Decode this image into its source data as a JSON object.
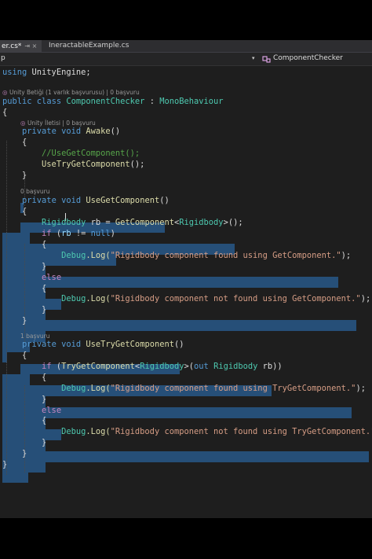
{
  "tabs": [
    {
      "label": "er.cs*",
      "pin": "⇥ ×"
    },
    {
      "label": "IneractableExample.cs"
    }
  ],
  "navbar": {
    "left": "p",
    "dropdown_glyph": "▾",
    "right": "ComponentChecker"
  },
  "code": {
    "using_kw": "using",
    "using_ns": " UnityEngine;",
    "lens_class": "Unity Betiği (1 varlık başvurusu) | 0 başvuru",
    "class_line": {
      "public": "public",
      "class": " class ",
      "name": "ComponentChecker",
      "colon": " : ",
      "base": "MonoBehaviour"
    },
    "brace_open": "{",
    "brace_close": "}",
    "lens_awake": "Unity İletisi | 0 başvuru",
    "awake_private": "private",
    "awake_void": " void ",
    "awake_name": "Awake",
    "parens": "()",
    "awake_comment": "//UseGetComponent();",
    "awake_call": "UseTryGetComponent",
    "call_end": "();",
    "lens_use": "0 başvuru",
    "use_name": "UseGetComponent",
    "rb_type": "Rigidbody",
    "rb_var": " rb = ",
    "get_comp": "GetComponent",
    "lt": "<",
    "gt_end": ">();",
    "if_kw": "if",
    "if_open": " (",
    "rb_name": "rb",
    "neq": " != ",
    "null_kw": "null",
    "rparen": ")",
    "debug": "Debug",
    "log": ".Log(",
    "str_found": "\"Rigidbody component found using GetComponent.\"",
    "str_notfound": "\"Rigidbody component not found using GetComponent.\"",
    "end_stmt": ");",
    "else_kw": "else",
    "lens_try": "1 başvuru",
    "try_name": "UseTryGetComponent",
    "try_call": "TryGetComponent",
    "out_open": ">(",
    "out_kw": "out",
    "rb_decl_end": " rb))",
    "str_try_found": "\"Rigidbody component found using TryGetComponent.\"",
    "str_try_notfound": "\"Rigidbody component not found using TryGetComponent.\"",
    "space": " "
  },
  "colors": {
    "keyword": "#569cd6",
    "type": "#4ec9b0",
    "method": "#dcdcaa",
    "string": "#d69d85",
    "comment": "#57a64a",
    "selection": "#264f78"
  }
}
